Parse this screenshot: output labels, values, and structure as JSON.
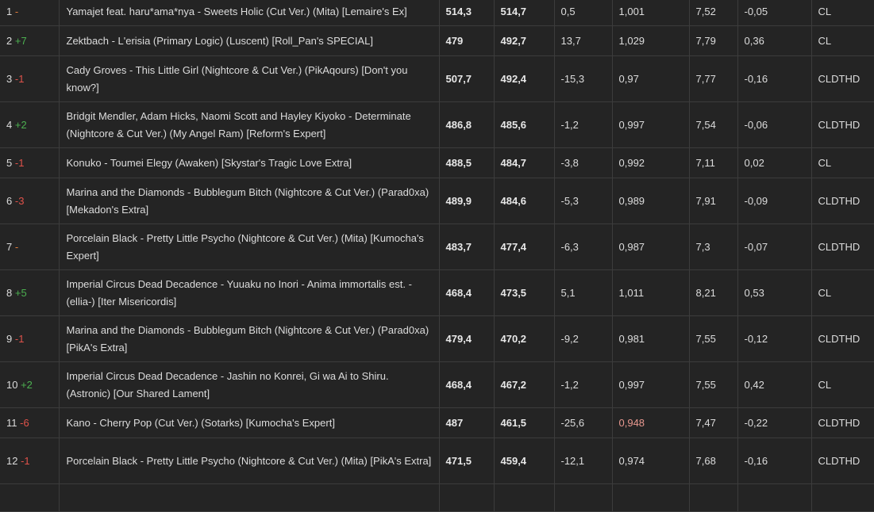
{
  "rows": [
    {
      "rank": "1",
      "change": "-",
      "dir": "same",
      "map": "Yamajet feat. haru*ama*nya - Sweets Holic (Cut Ver.) (Mita) [Lemaire's Ex]",
      "v1": "514,3",
      "v2": "514,7",
      "diff": "0,5",
      "ratio": "1,001",
      "stars": "7,52",
      "delta": "-0,05",
      "mods": "CL"
    },
    {
      "rank": "2",
      "change": "+7",
      "dir": "up",
      "map": "Zektbach - L'erisia (Primary Logic) (Luscent) [Roll_Pan's SPECIAL]",
      "v1": "479",
      "v2": "492,7",
      "diff": "13,7",
      "ratio": "1,029",
      "stars": "7,79",
      "delta": "0,36",
      "mods": "CL"
    },
    {
      "rank": "3",
      "change": "-1",
      "dir": "down",
      "map": "Cady Groves - This Little Girl (Nightcore & Cut Ver.) (PikAqours) [Don't you know?]",
      "v1": "507,7",
      "v2": "492,4",
      "diff": "-15,3",
      "ratio": "0,97",
      "stars": "7,77",
      "delta": "-0,16",
      "mods": "CLDTHD"
    },
    {
      "rank": "4",
      "change": "+2",
      "dir": "up",
      "map": "Bridgit Mendler, Adam Hicks, Naomi Scott and Hayley Kiyoko - Determinate (Nightcore & Cut Ver.) (My Angel Ram) [Reform's Expert]",
      "v1": "486,8",
      "v2": "485,6",
      "diff": "-1,2",
      "ratio": "0,997",
      "stars": "7,54",
      "delta": "-0,06",
      "mods": "CLDTHD"
    },
    {
      "rank": "5",
      "change": "-1",
      "dir": "down",
      "map": "Konuko - Toumei Elegy (Awaken) [Skystar's Tragic Love Extra]",
      "v1": "488,5",
      "v2": "484,7",
      "diff": "-3,8",
      "ratio": "0,992",
      "stars": "7,11",
      "delta": "0,02",
      "mods": "CL"
    },
    {
      "rank": "6",
      "change": "-3",
      "dir": "down",
      "map": "Marina and the Diamonds - Bubblegum Bitch (Nightcore & Cut Ver.) (Parad0xa) [Mekadon's Extra]",
      "v1": "489,9",
      "v2": "484,6",
      "diff": "-5,3",
      "ratio": "0,989",
      "stars": "7,91",
      "delta": "-0,09",
      "mods": "CLDTHD"
    },
    {
      "rank": "7",
      "change": "-",
      "dir": "same",
      "map": "Porcelain Black - Pretty Little Psycho (Nightcore & Cut Ver.) (Mita) [Kumocha's Expert]",
      "v1": "483,7",
      "v2": "477,4",
      "diff": "-6,3",
      "ratio": "0,987",
      "stars": "7,3",
      "delta": "-0,07",
      "mods": "CLDTHD"
    },
    {
      "rank": "8",
      "change": "+5",
      "dir": "up",
      "map": "Imperial Circus Dead Decadence - Yuuaku no Inori - Anima immortalis est. - (ellia-) [Iter Misericordis]",
      "v1": "468,4",
      "v2": "473,5",
      "diff": "5,1",
      "ratio": "1,011",
      "stars": "8,21",
      "delta": "0,53",
      "mods": "CL"
    },
    {
      "rank": "9",
      "change": "-1",
      "dir": "down",
      "map": "Marina and the Diamonds - Bubblegum Bitch (Nightcore & Cut Ver.) (Parad0xa) [PikA's Extra]",
      "v1": "479,4",
      "v2": "470,2",
      "diff": "-9,2",
      "ratio": "0,981",
      "stars": "7,55",
      "delta": "-0,12",
      "mods": "CLDTHD"
    },
    {
      "rank": "10",
      "change": "+2",
      "dir": "up",
      "map": "Imperial Circus Dead Decadence - Jashin no Konrei, Gi wa Ai to Shiru. (Astronic) [Our Shared Lament]",
      "v1": "468,4",
      "v2": "467,2",
      "diff": "-1,2",
      "ratio": "0,997",
      "stars": "7,55",
      "delta": "0,42",
      "mods": "CL"
    },
    {
      "rank": "11",
      "change": "-6",
      "dir": "down",
      "map": "Kano - Cherry Pop (Cut Ver.) (Sotarks) [Kumocha's Expert]",
      "v1": "487",
      "v2": "461,5",
      "diff": "-25,6",
      "ratio": "0,948",
      "stars": "7,47",
      "delta": "-0,22",
      "mods": "CLDTHD",
      "ratio_red": true
    },
    {
      "rank": "12",
      "change": "-1",
      "dir": "down",
      "map": "Porcelain Black - Pretty Little Psycho (Nightcore & Cut Ver.) (Mita) [PikA's Extra]",
      "v1": "471,5",
      "v2": "459,4",
      "diff": "-12,1",
      "ratio": "0,974",
      "stars": "7,68",
      "delta": "-0,16",
      "mods": "CLDTHD"
    }
  ],
  "colors": {
    "up": "#4cb050",
    "down": "#e0524a",
    "same": "#e07b3a",
    "highlight_ratio": "#e8988f"
  }
}
